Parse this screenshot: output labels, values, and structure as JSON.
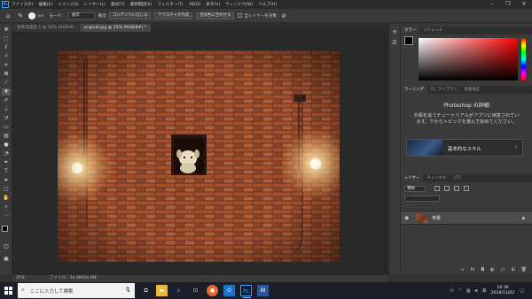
{
  "menubar": {
    "items": [
      "ファイル(F)",
      "編集(E)",
      "イメージ(I)",
      "レイヤー(L)",
      "書式(Y)",
      "選択範囲(S)",
      "フィルター(T)",
      "3D(D)",
      "表示(V)",
      "ウィンドウ(W)",
      "ヘルプ(H)"
    ],
    "window_controls": [
      "–",
      "❐",
      "✕"
    ]
  },
  "options": {
    "brush_size": "100",
    "mode_label": "モード：",
    "mode_value": "通常",
    "sample_label": "検出",
    "content_aware_button": "コンテンツに応じる",
    "create_texture_button": "テクスチャを作成",
    "proximity_button": "近似色に合わせる",
    "all_layers_label": "全レイヤーを対象"
  },
  "tabs": {
    "untitled": "名称未設定 1 @ 50% (RGB/8)",
    "active": "original.jpg @ 25% (RGB/8#) *"
  },
  "status": {
    "zoom": "25%",
    "file_info": "ファイル：34.9M/34.9M"
  },
  "panels": {
    "color_tabs": [
      "カラー",
      "スウォッチ"
    ],
    "learn_tabs": [
      "ラーニング",
      "CC ライブラリ",
      "色調補正"
    ],
    "learn_title": "Photoshop の詳細",
    "learn_desc": "手順を追うチュートリアルがアプリに用意されています。下からトピックを選んで始めてください。",
    "skill_label": "基本的なスキル",
    "layers_tabs": [
      "レイヤー",
      "チャンネル",
      "パス"
    ],
    "layer_filter": "種類",
    "layer_name": "背景"
  },
  "taskbar": {
    "search_placeholder": "ここに入力して検索",
    "time": "16:36",
    "date": "2018/11/02"
  },
  "colors": {
    "accent": "#31a8ff",
    "canvas_bg": "#282828",
    "panel_bg": "#3a3a3a",
    "brick": "#9a4a2a"
  }
}
